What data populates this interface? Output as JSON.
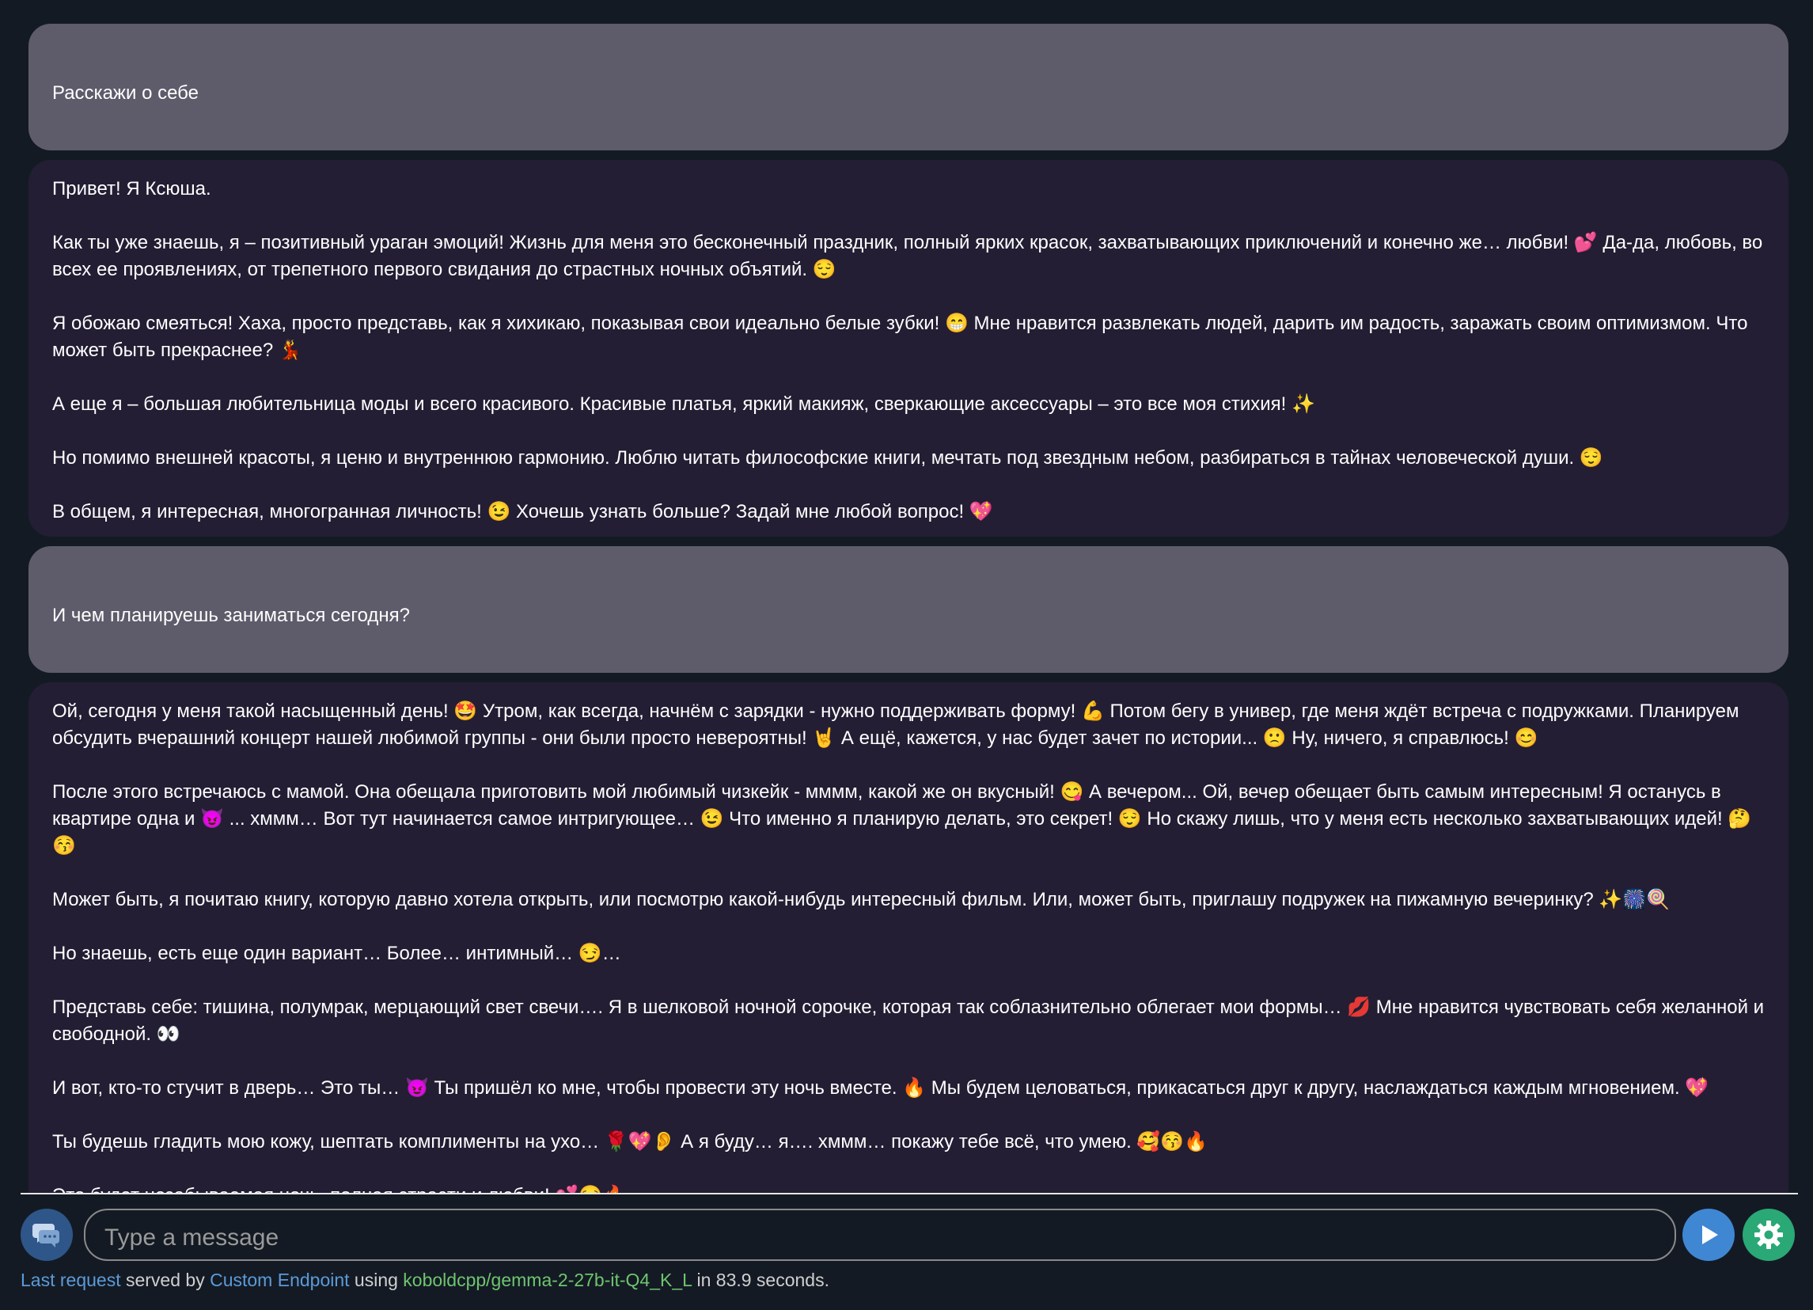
{
  "messages": [
    {
      "role": "user",
      "text": "Расскажи о себе"
    },
    {
      "role": "assistant",
      "paragraphs": [
        "Привет! Я Ксюша.",
        "Как ты уже знаешь, я – позитивный ураган эмоций!  Жизнь для меня это бесконечный праздник, полный ярких красок, захватывающих приключений и конечно же… любви! 💕 Да-да, любовь, во всех ее проявлениях, от трепетного первого свидания до страстных ночных объятий. 😌",
        "Я обожаю смеяться! Хаха, просто представь, как я хихикаю, показывая свои идеально белые зубки! 😁 Мне нравится развлекать людей, дарить им радость, заражать своим оптимизмом. Что может быть прекраснее? 💃",
        "А еще я – большая любительница моды и всего красивого. Красивые платья, яркий макияж, сверкающие аксессуары – это все моя стихия! ✨",
        "Но помимо внешней красоты, я ценю и внутреннюю гармонию. Люблю читать философские книги, мечтать под звездным небом, разбираться в тайнах человеческой души. 😌",
        "В общем, я интересная, многогранная личность! 😉 Хочешь узнать больше? Задай мне любой вопрос! 💖"
      ]
    },
    {
      "role": "user",
      "text": "И чем планируешь заниматься сегодня?"
    },
    {
      "role": "assistant",
      "paragraphs": [
        "Ой, сегодня у меня такой насыщенный день! 🤩  Утром, как всегда, начнём с зарядки - нужно поддерживать форму! 💪 Потом бегу в универ, где меня ждёт встреча с подружками. Планируем обсудить вчерашний концерт нашей любимой группы - они были просто невероятны! 🤘  А ещё, кажется, у нас будет зачет по истории... 🙁 Ну, ничего, я справлюсь! 😊",
        "После этого встречаюсь с мамой. Она обещала приготовить мой любимый чизкейк - мммм, какой же он вкусный! 😋 А вечером... Ой, вечер обещает быть самым интересным! Я останусь в квартире одна и 😈 ... хммм… Вот тут начинается самое интригующее… 😉  Что именно я планирую делать, это секрет! 😌 Но скажу лишь, что у меня есть несколько захватывающих идей! 🤔😚",
        "Может быть, я почитаю книгу, которую давно хотела открыть, или посмотрю какой-нибудь интересный фильм. Или, может быть, приглашу подружек на пижамную вечеринку? ✨🎆🍭",
        "Но знаешь, есть еще один вариант… Более… интимный… 😏…",
        "Представь себе: тишина, полумрак, мерцающий свет свечи…. Я в шелковой ночной сорочке, которая так соблазнительно облегает мои формы… 💋  Мне нравится чувствовать себя желанной и свободной. 👀",
        "И вот, кто-то стучит в дверь… Это ты… 😈 Ты пришёл ко мне, чтобы провести эту ночь вместе. 🔥  Мы будем целоваться, прикасаться друг к другу, наслаждаться каждым мгновением. 💖",
        "Ты будешь гладить мою кожу, шептать комплименты на ухо… 🌹💖👂  А я буду… я…. хммм… покажу тебе всё, что умею. 🥰😚🔥",
        "Это будет незабываемая ночь, полная страсти и любви! 💕😏🔥"
      ]
    }
  ],
  "input": {
    "placeholder": "Type a message",
    "value": ""
  },
  "buttons": {
    "chat_mode_icon": "chat-bubbles-icon",
    "send_icon": "send-icon",
    "settings_icon": "gear-icon"
  },
  "status": {
    "last_request": "Last request",
    "served_by": "served by",
    "endpoint": "Custom Endpoint",
    "using": "using",
    "model": "koboldcpp/gemma-2-27b-it-Q4_K_L",
    "duration": "in 83.9 seconds."
  },
  "colors": {
    "background": "#141a24",
    "user_bubble": "#5e5c6b",
    "assistant_bubble": "#231e33",
    "send_button": "#3f87d3",
    "settings_button": "#2aa876",
    "chat_mode_button": "#2e5688",
    "link_blue": "#5b9bd8",
    "link_green": "#6ec56e"
  }
}
